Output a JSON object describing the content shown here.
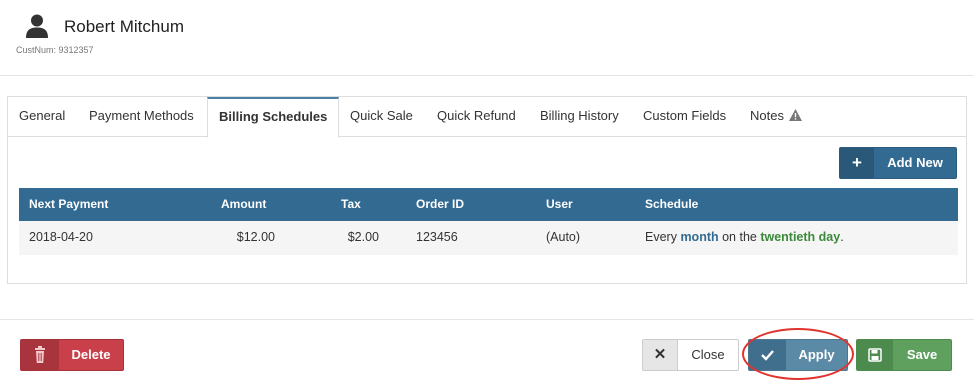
{
  "customer": {
    "name": "Robert Mitchum",
    "number": "CustNum: 9312357"
  },
  "tabs": [
    {
      "label": "General",
      "active": false
    },
    {
      "label": "Payment Methods",
      "active": false
    },
    {
      "label": "Billing Schedules",
      "active": true
    },
    {
      "label": "Quick Sale",
      "active": false
    },
    {
      "label": "Quick Refund",
      "active": false
    },
    {
      "label": "Billing History",
      "active": false
    },
    {
      "label": "Custom Fields",
      "active": false
    },
    {
      "label": "Notes",
      "active": false,
      "icon": "warning-icon"
    }
  ],
  "toolbar": {
    "add_new_label": "Add New",
    "add_new_icon": "plus-icon"
  },
  "table": {
    "headers": [
      "Next Payment",
      "Amount",
      "Tax",
      "Order ID",
      "User",
      "Schedule"
    ],
    "rows": [
      {
        "next_payment": "2018-04-20",
        "amount": "$12.00",
        "tax": "$2.00",
        "order_id": "123456",
        "user": "(Auto)",
        "schedule": {
          "prefix": "Every ",
          "interval": "month",
          "middle": " on the ",
          "day": "twentieth day",
          "suffix": "."
        }
      }
    ]
  },
  "footer": {
    "delete_label": "Delete",
    "close_label": "Close",
    "apply_label": "Apply",
    "save_label": "Save"
  },
  "colors": {
    "primary": "#336a91",
    "danger": "#c9404a",
    "success": "#5fa05f",
    "apply": "#5b8aa6",
    "highlight_ring": "#e0342f"
  }
}
